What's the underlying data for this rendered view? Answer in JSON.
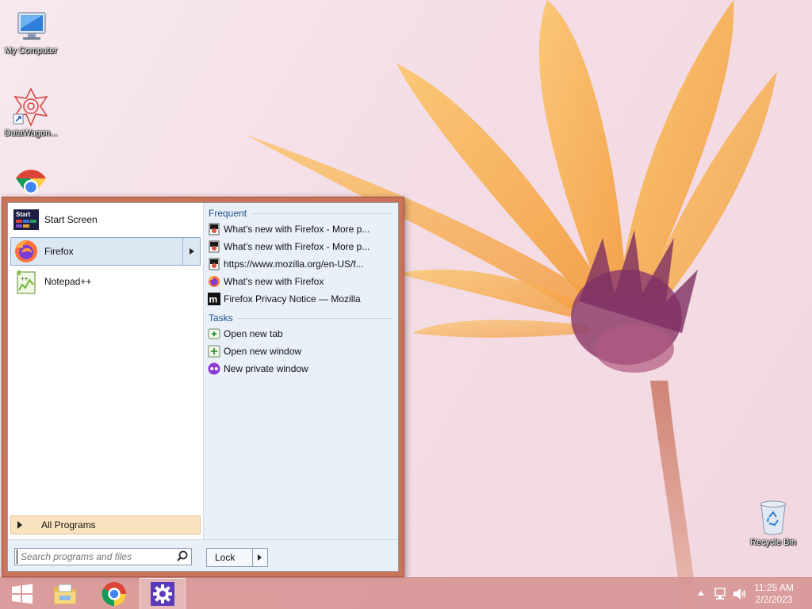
{
  "desktop": {
    "icons": [
      {
        "label": "My Computer"
      },
      {
        "label": "DataWagon..."
      },
      {
        "label": "Google Chrome"
      },
      {
        "label": "Recycle Bin"
      }
    ]
  },
  "start_menu": {
    "pinned": [
      {
        "label": "Start Screen",
        "icon": "start-screen-icon"
      },
      {
        "label": "Firefox",
        "icon": "firefox-icon",
        "selected": true
      },
      {
        "label": "Notepad++",
        "icon": "notepadpp-icon"
      }
    ],
    "all_programs_label": "All Programs",
    "jumplist": {
      "frequent_header": "Frequent",
      "frequent": [
        {
          "label": "What's new with Firefox - More p...",
          "icon": "mozilla-page-icon"
        },
        {
          "label": "What's new with Firefox - More p...",
          "icon": "mozilla-page-icon"
        },
        {
          "label": "https://www.mozilla.org/en-US/f...",
          "icon": "mozilla-page-icon"
        },
        {
          "label": "What's new with Firefox",
          "icon": "firefox-icon"
        },
        {
          "label": "Firefox Privacy Notice — Mozilla",
          "icon": "mozilla-m-icon"
        }
      ],
      "tasks_header": "Tasks",
      "tasks": [
        {
          "label": "Open new tab",
          "icon": "new-tab-icon"
        },
        {
          "label": "Open new window",
          "icon": "new-window-icon"
        },
        {
          "label": "New private window",
          "icon": "private-window-icon"
        }
      ]
    },
    "search": {
      "placeholder": "Search programs and files",
      "value": ""
    },
    "lock_label": "Lock"
  },
  "taskbar": {
    "buttons": [
      {
        "name": "start-button",
        "icon": "windows-logo-icon"
      },
      {
        "name": "file-explorer",
        "icon": "folder-icon"
      },
      {
        "name": "chrome",
        "icon": "chrome-icon"
      },
      {
        "name": "settings",
        "icon": "gear-icon",
        "active": true
      }
    ],
    "clock": {
      "time": "11:25 AM",
      "date": "2/2/2023"
    }
  },
  "colors": {
    "start_menu_frame": "#c9735a",
    "taskbar": "#d89696",
    "jumplist_bg": "#e9f0f8",
    "all_programs_bg": "#fbe3c0"
  }
}
